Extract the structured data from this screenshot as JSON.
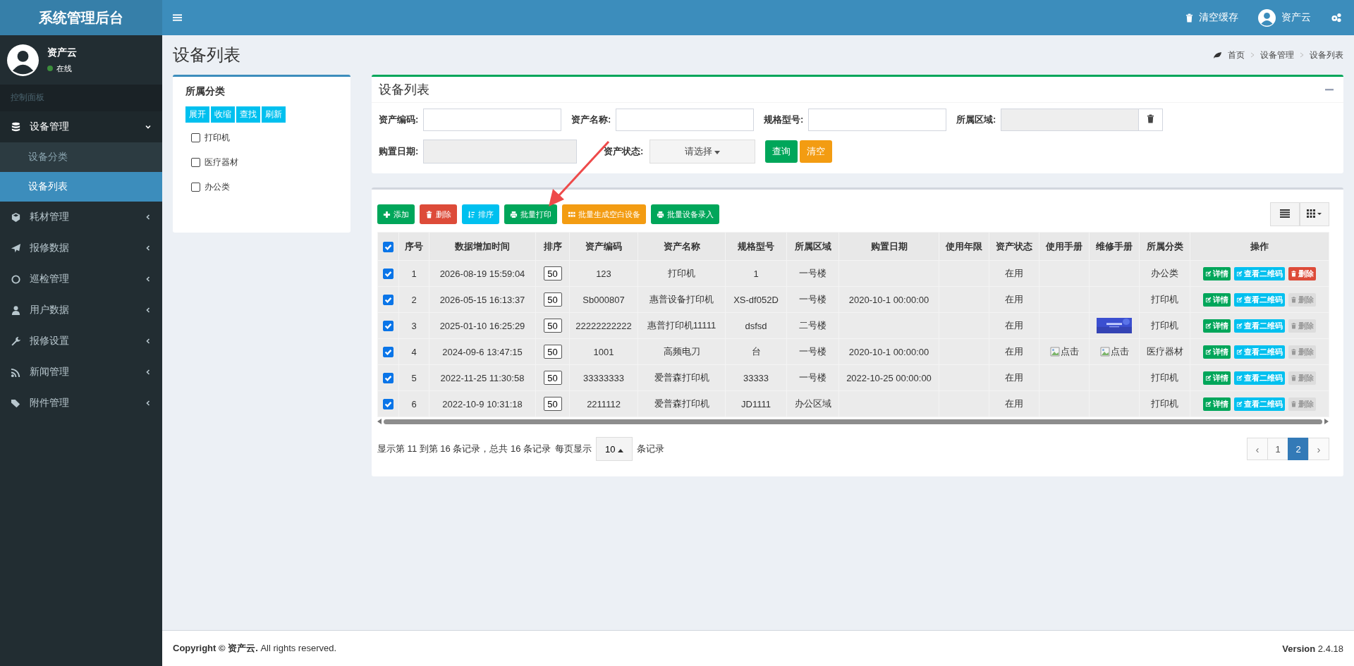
{
  "brand": "系统管理后台",
  "user": {
    "name": "资产云",
    "status": "在线",
    "online": true
  },
  "sidebar": {
    "header": "控制面板",
    "items": [
      {
        "label": "设备管理",
        "kind": "database",
        "expanded": true,
        "children": [
          {
            "label": "设备分类",
            "selected": false
          },
          {
            "label": "设备列表",
            "selected": true
          }
        ]
      },
      {
        "label": "耗材管理",
        "kind": "cube",
        "expanded": false
      },
      {
        "label": "报修数据",
        "kind": "plane",
        "expanded": false
      },
      {
        "label": "巡检管理",
        "kind": "circle",
        "expanded": false
      },
      {
        "label": "用户数据",
        "kind": "user",
        "expanded": false
      },
      {
        "label": "报修设置",
        "kind": "wrench",
        "expanded": false
      },
      {
        "label": "新闻管理",
        "kind": "rss",
        "expanded": false
      },
      {
        "label": "附件管理",
        "kind": "tags",
        "expanded": false
      }
    ]
  },
  "topbar": {
    "clear_cache": "清空缓存",
    "user": "资产云"
  },
  "page_title": "设备列表",
  "breadcrumb": [
    "首页",
    "设备管理",
    "设备列表"
  ],
  "category_panel": {
    "title": "所属分类",
    "buttons": [
      "展开",
      "收缩",
      "查找",
      "刷新"
    ],
    "items": [
      {
        "label": "打印机",
        "checked": false
      },
      {
        "label": "医疗器材",
        "checked": false
      },
      {
        "label": "办公类",
        "checked": false
      }
    ]
  },
  "filter_panel": {
    "title": "设备列表",
    "fields": [
      {
        "label": "资产编码:",
        "kind": "text"
      },
      {
        "label": "资产名称:",
        "kind": "text"
      },
      {
        "label": "规格型号:",
        "kind": "text"
      },
      {
        "label": "所属区域:",
        "kind": "picker"
      },
      {
        "label": "购置日期:",
        "kind": "date"
      },
      {
        "label": "资产状态:",
        "kind": "select",
        "value": "请选择"
      }
    ],
    "buttons": [
      {
        "label": "查询",
        "kind": "query"
      },
      {
        "label": "清空",
        "kind": "clear"
      }
    ]
  },
  "toolbar": [
    {
      "label": "添加",
      "kind": "add"
    },
    {
      "label": "删除",
      "kind": "delete"
    },
    {
      "label": "排序",
      "kind": "sort"
    },
    {
      "label": "批量打印",
      "kind": "print"
    },
    {
      "label": "批量生成空白设备",
      "kind": "blank"
    },
    {
      "label": "批量设备录入",
      "kind": "import"
    }
  ],
  "table": {
    "all_checked": true,
    "columns": [
      "序号",
      "数据增加时间",
      "排序",
      "资产编码",
      "资产名称",
      "规格型号",
      "所属区域",
      "购置日期",
      "使用年限",
      "资产状态",
      "使用手册",
      "维修手册",
      "所属分类",
      "操作"
    ],
    "rows": [
      {
        "checked": true,
        "cells": [
          "1",
          "2026-08-19 15:59:04",
          "50",
          "123",
          "打印机",
          "1",
          "一号楼",
          "",
          "",
          "在用"
        ],
        "manual": null,
        "repair_manual": null,
        "category": "办公类",
        "actions": [
          {
            "label": "详情",
            "kind": "detail"
          },
          {
            "label": "查看二维码",
            "kind": "qrcode"
          },
          {
            "label": "删除",
            "kind": "delete",
            "disabled": false
          }
        ]
      },
      {
        "checked": true,
        "cells": [
          "2",
          "2026-05-15 16:13:37",
          "50",
          "Sb000807",
          "惠普设备打印机",
          "XS-df052D",
          "一号楼",
          "2020-10-1 00:00:00",
          "",
          "在用"
        ],
        "manual": null,
        "repair_manual": null,
        "category": "打印机",
        "actions": [
          {
            "label": "详情",
            "kind": "detail"
          },
          {
            "label": "查看二维码",
            "kind": "qrcode"
          },
          {
            "label": "删除",
            "kind": "delete",
            "disabled": true
          }
        ]
      },
      {
        "checked": true,
        "cells": [
          "3",
          "2025-01-10 16:25:29",
          "50",
          "22222222222",
          "惠普打印机11111",
          "dsfsd",
          "二号楼",
          "",
          "",
          "在用"
        ],
        "manual": null,
        "repair_manual": {
          "kind": "picture"
        },
        "category": "打印机",
        "actions": [
          {
            "label": "详情",
            "kind": "detail"
          },
          {
            "label": "查看二维码",
            "kind": "qrcode"
          },
          {
            "label": "删除",
            "kind": "delete",
            "disabled": true
          }
        ]
      },
      {
        "checked": true,
        "cells": [
          "4",
          "2024-09-6 13:47:15",
          "50",
          "1001",
          "高频电刀",
          "台",
          "一号楼",
          "2020-10-1 00:00:00",
          "",
          "在用"
        ],
        "manual": {
          "kind": "broken",
          "alt": "点击"
        },
        "repair_manual": {
          "kind": "broken",
          "alt": "点击"
        },
        "category": "医疗器材",
        "actions": [
          {
            "label": "详情",
            "kind": "detail"
          },
          {
            "label": "查看二维码",
            "kind": "qrcode"
          },
          {
            "label": "删除",
            "kind": "delete",
            "disabled": true
          }
        ]
      },
      {
        "checked": true,
        "cells": [
          "5",
          "2022-11-25 11:30:58",
          "50",
          "33333333",
          "爱普森打印机",
          "33333",
          "一号楼",
          "2022-10-25 00:00:00",
          "",
          "在用"
        ],
        "manual": null,
        "repair_manual": null,
        "category": "打印机",
        "actions": [
          {
            "label": "详情",
            "kind": "detail"
          },
          {
            "label": "查看二维码",
            "kind": "qrcode"
          },
          {
            "label": "删除",
            "kind": "delete",
            "disabled": true
          }
        ]
      },
      {
        "checked": true,
        "cells": [
          "6",
          "2022-10-9 10:31:18",
          "50",
          "2211112",
          "爱普森打印机",
          "JD1111",
          "办公区域",
          "",
          "",
          "在用"
        ],
        "manual": null,
        "repair_manual": null,
        "category": "打印机",
        "actions": [
          {
            "label": "详情",
            "kind": "detail"
          },
          {
            "label": "查看二维码",
            "kind": "qrcode"
          },
          {
            "label": "删除",
            "kind": "delete",
            "disabled": true
          }
        ]
      }
    ]
  },
  "pagination": {
    "summary": "显示第 11 到第 16 条记录，总共 16 条记录",
    "per_page_label": "每页显示",
    "per_page": "10",
    "per_page_suffix": "条记录",
    "pages": [
      {
        "label": "‹",
        "kind": "prev",
        "selected": false
      },
      {
        "label": "1",
        "kind": "page",
        "selected": false
      },
      {
        "label": "2",
        "kind": "page",
        "selected": true
      },
      {
        "label": "›",
        "kind": "next",
        "selected": false
      }
    ]
  },
  "footer": {
    "copyright": "**Copyright © 资产云.** All rights reserved.",
    "version": "**Version** 2.4.18"
  }
}
